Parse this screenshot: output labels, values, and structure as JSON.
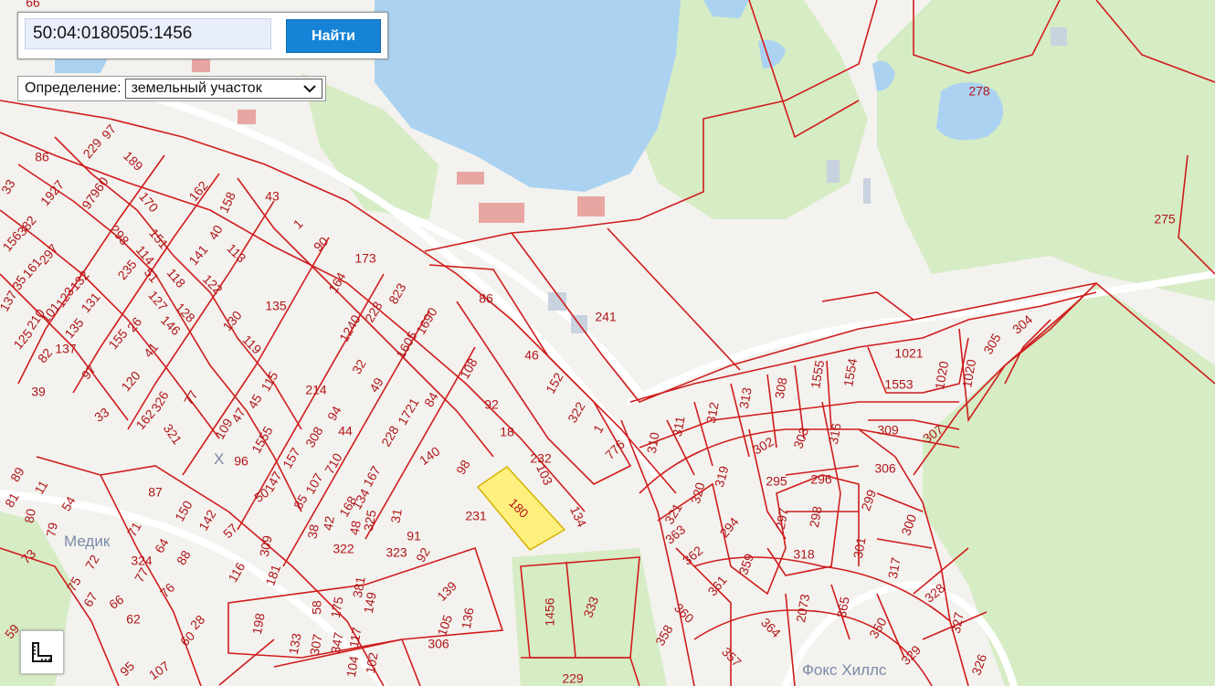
{
  "search": {
    "value": "50:04:0180505:1456",
    "button_label": "Найти"
  },
  "definition": {
    "label": "Определение:",
    "selected": "земельный участок"
  },
  "controls": {
    "ruler_icon": "ruler-icon"
  },
  "map": {
    "selected_parcel": "1456",
    "place_names": [
      "Медик",
      "Фокс Хиллс",
      "Х"
    ],
    "colors": {
      "parcel": "#d01c1c",
      "selected_fill": "#fff06a",
      "water": "#abd3f1",
      "forest": "#d6ecc5"
    },
    "parcel_numbers": [
      "66",
      "97",
      "229",
      "189",
      "86",
      "1927",
      "97960",
      "170",
      "162",
      "158",
      "33",
      "382",
      "156",
      "297",
      "161",
      "298",
      "151",
      "114",
      "40",
      "113",
      "235",
      "141",
      "137",
      "35",
      "132",
      "123",
      "101",
      "51",
      "210",
      "131",
      "118",
      "122",
      "135",
      "127",
      "128",
      "135",
      "125",
      "82",
      "137",
      "155",
      "26",
      "146",
      "130",
      "119",
      "97",
      "41",
      "120",
      "326",
      "115",
      "45",
      "77",
      "47",
      "33",
      "162",
      "321",
      "109",
      "1555",
      "39",
      "214",
      "43",
      "1",
      "90",
      "173",
      "164",
      "228",
      "823",
      "1240",
      "1690",
      "1605",
      "32",
      "49",
      "1721",
      "84",
      "108",
      "86",
      "46",
      "152",
      "322",
      "1",
      "776",
      "92",
      "18",
      "228",
      "140",
      "98",
      "157",
      "308",
      "710",
      "94",
      "44",
      "96",
      "147",
      "107",
      "50",
      "85",
      "167",
      "134",
      "168",
      "38",
      "42",
      "48",
      "325",
      "31",
      "91",
      "92",
      "116",
      "309",
      "181",
      "87",
      "150",
      "142",
      "57",
      "89",
      "11",
      "54",
      "81",
      "80",
      "79",
      "73",
      "72",
      "71",
      "64",
      "88",
      "77",
      "76",
      "75",
      "67",
      "66",
      "62",
      "28",
      "60",
      "59",
      "95",
      "107",
      "198",
      "58",
      "175",
      "381",
      "149",
      "133",
      "307",
      "347",
      "117",
      "104",
      "102",
      "105",
      "139",
      "136",
      "306",
      "180",
      "103",
      "134",
      "1456",
      "333",
      "229",
      "231",
      "232",
      "241",
      "278",
      "275",
      "1021",
      "1020",
      "1020",
      "305",
      "304",
      "1553",
      "1554",
      "1555",
      "308",
      "313",
      "312",
      "311",
      "310",
      "309",
      "307",
      "306",
      "302",
      "303",
      "316",
      "295",
      "296",
      "297",
      "298",
      "299",
      "300",
      "301",
      "317",
      "318",
      "319",
      "320",
      "321",
      "294",
      "363",
      "362",
      "359",
      "361",
      "360",
      "358",
      "357",
      "364",
      "2073",
      "365",
      "350",
      "329",
      "328",
      "327",
      "326",
      "322",
      "323",
      "324",
      "118",
      "123",
      "67"
    ]
  }
}
